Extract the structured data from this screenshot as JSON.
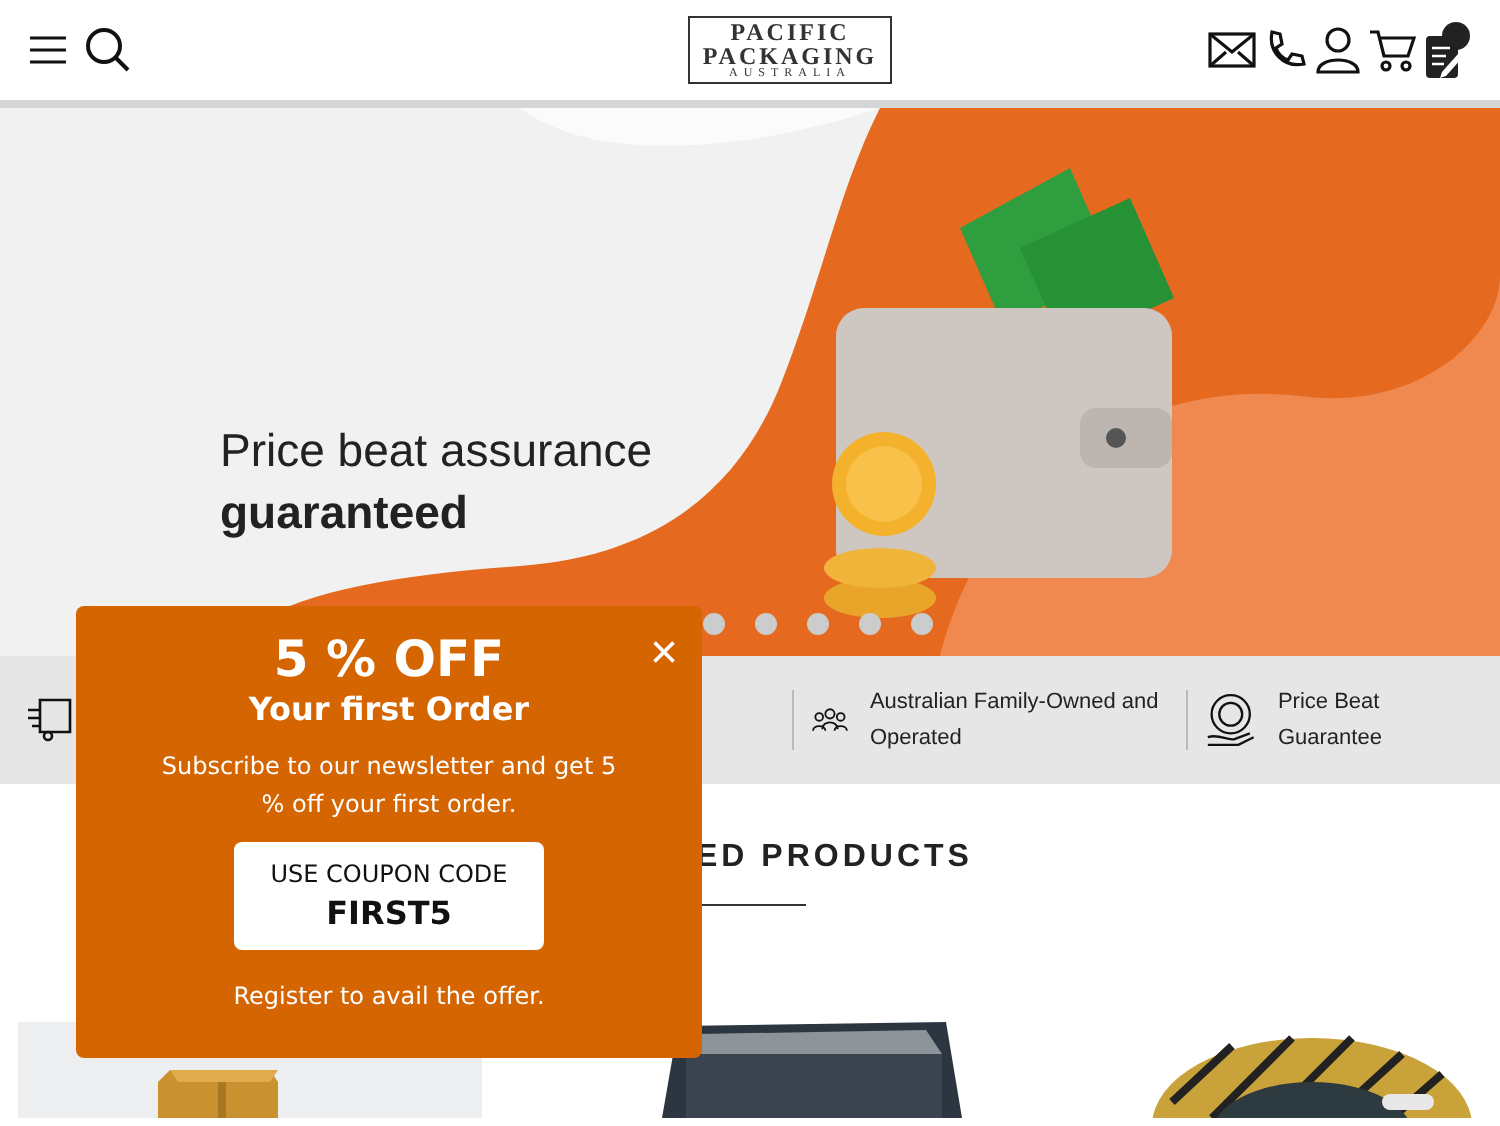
{
  "header": {
    "logo": {
      "line_1": "PACIFIC",
      "line_2": "PACKAGING",
      "line_3": "AUSTRALIA"
    }
  },
  "banner": {
    "kind": "picture",
    "headline": "Price beat assurance",
    "emphasis": "guaranteed"
  },
  "features": [
    {
      "kind": "delivery"
    },
    {
      "kind": "family",
      "text": "Australian Family-Owned and Operated"
    },
    {
      "kind": "price",
      "text": "Price Beat Guarantee"
    }
  ],
  "section": {
    "heading": "ED PRODUCTS"
  },
  "popup": {
    "title": "5 % OFF",
    "subtitle": "Your first Order",
    "body": "Subscribe to our newsletter and get 5 % off your first order.",
    "coupon_label": "USE COUPON CODE",
    "coupon_code": "FIRST5",
    "footer": "Register to avail the offer.",
    "close": "×"
  }
}
